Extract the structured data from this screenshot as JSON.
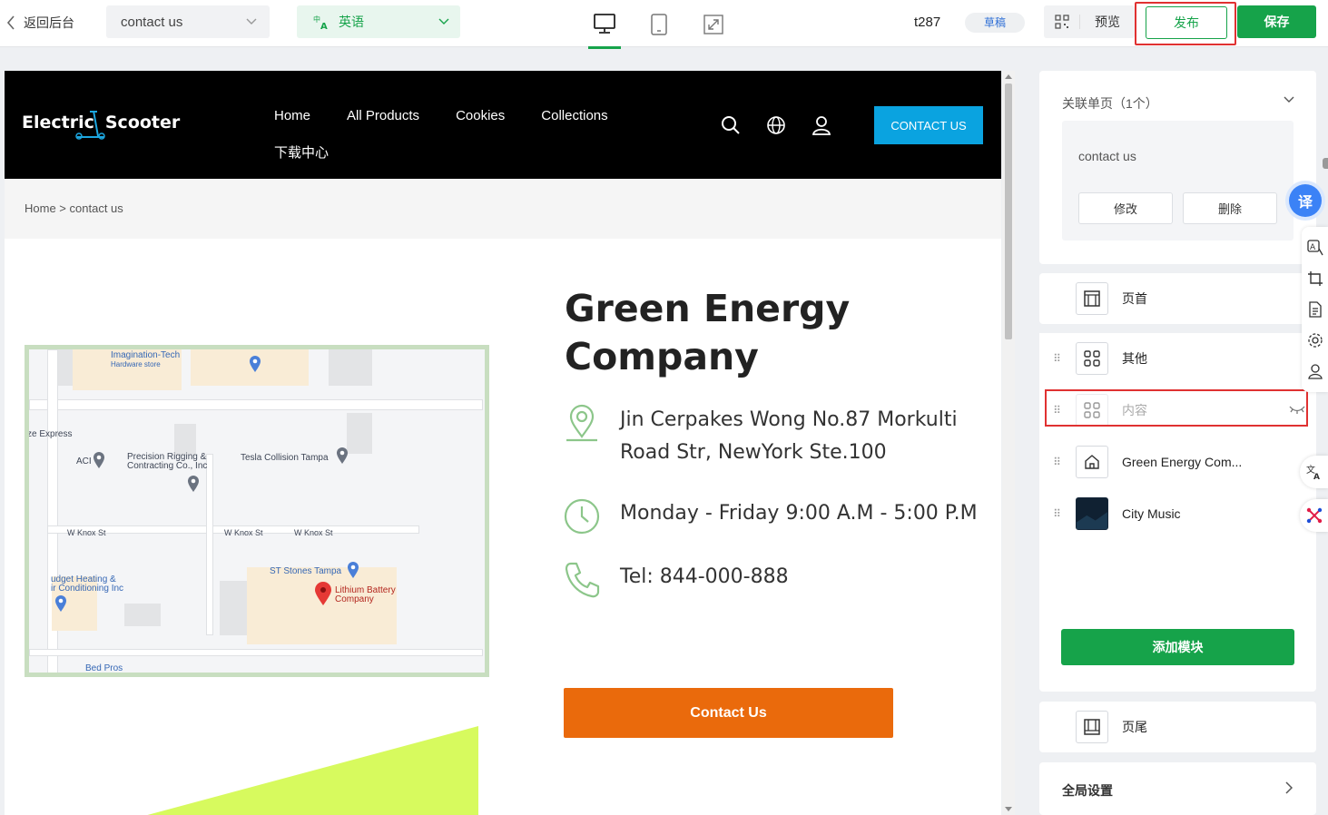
{
  "toolbar": {
    "back_label": "返回后台",
    "page_select": "contact us",
    "language_select": "英语",
    "page_id": "t287",
    "status_badge": "草稿",
    "preview_label": "预览",
    "publish_label": "发布",
    "save_label": "保存",
    "accent": "#16a34a"
  },
  "site": {
    "logo_left": "Electric",
    "logo_right": "Scooter",
    "nav_row1": [
      "Home",
      "All Products",
      "Cookies",
      "Collections"
    ],
    "nav_row2": [
      "下载中心"
    ],
    "contact_button": "CONTACT US",
    "breadcrumb_home": "Home",
    "breadcrumb_sep": " > ",
    "breadcrumb_current": "contact us",
    "company": "Green Energy Company",
    "address": "Jin Cerpakes Wong No.87 Morkulti Road Str, NewYork Ste.100",
    "hours": "Monday - Friday 9:00 A.M - 5:00 P.M",
    "tel": "Tel: 844-000-888",
    "cta": "Contact Us",
    "cta_color": "#ea6a0c",
    "header_button_color": "#0aa3e0"
  },
  "map_labels": {
    "imagination": "Imagination-Tech",
    "hardware": "Hardware store",
    "express": "ze Express",
    "aci": "ACI",
    "precision1": "Precision Rigging &",
    "precision2": "Contracting Co., Inc",
    "tesla": "Tesla Collision Tampa",
    "knox1": "W Knox St",
    "knox2": "W Knox St",
    "knox3": "W Knox St",
    "budget1": "udget Heating &",
    "budget2": "ir Conditioning Inc",
    "stones": "ST Stones Tampa",
    "lithium1": "Lithium Battery",
    "lithium2": "Company",
    "bed": "Bed Pros"
  },
  "panel": {
    "related_title": "关联单页（1个）",
    "related_page": "contact us",
    "edit_label": "修改",
    "delete_label": "删除",
    "modules": {
      "header": "页首",
      "other": "其他",
      "content": "内容",
      "green": "Green Energy Com...",
      "music": "City Music",
      "footer": "页尾"
    },
    "add_module": "添加模块",
    "global_settings": "全局设置",
    "translate_glyph": "译"
  }
}
